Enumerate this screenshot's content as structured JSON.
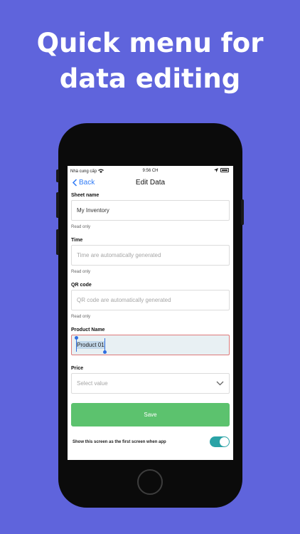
{
  "headline": [
    "Quick menu for",
    "data editing"
  ],
  "status_bar": {
    "carrier": "Nhà cung cấp",
    "time": "9:56 CH"
  },
  "nav": {
    "back_label": "Back",
    "title": "Edit Data"
  },
  "fields": {
    "sheet_name": {
      "label": "Sheet name",
      "value": "My Inventory",
      "hint": "Read only"
    },
    "time": {
      "label": "Time",
      "placeholder": "Time are automatically generated",
      "hint": "Read only"
    },
    "qr_code": {
      "label": "QR code",
      "placeholder": "QR code are automatically generated",
      "hint": "Read only"
    },
    "product_name": {
      "label": "Product Name",
      "value": "Product 01"
    },
    "price": {
      "label": "Price",
      "placeholder": "Select value"
    }
  },
  "save_label": "Save",
  "toggle": {
    "label": "Show this screen as the first screen when app",
    "on": true
  },
  "colors": {
    "background": "#5f64dc",
    "accent_link": "#2f7bf6",
    "save_button": "#5cc26e",
    "error_border": "#de7a7a",
    "toggle_on": "#2aa3a6"
  },
  "icons": [
    "wifi-icon",
    "location-arrow-icon",
    "battery-icon",
    "chevron-left-icon",
    "chevron-down-icon"
  ]
}
